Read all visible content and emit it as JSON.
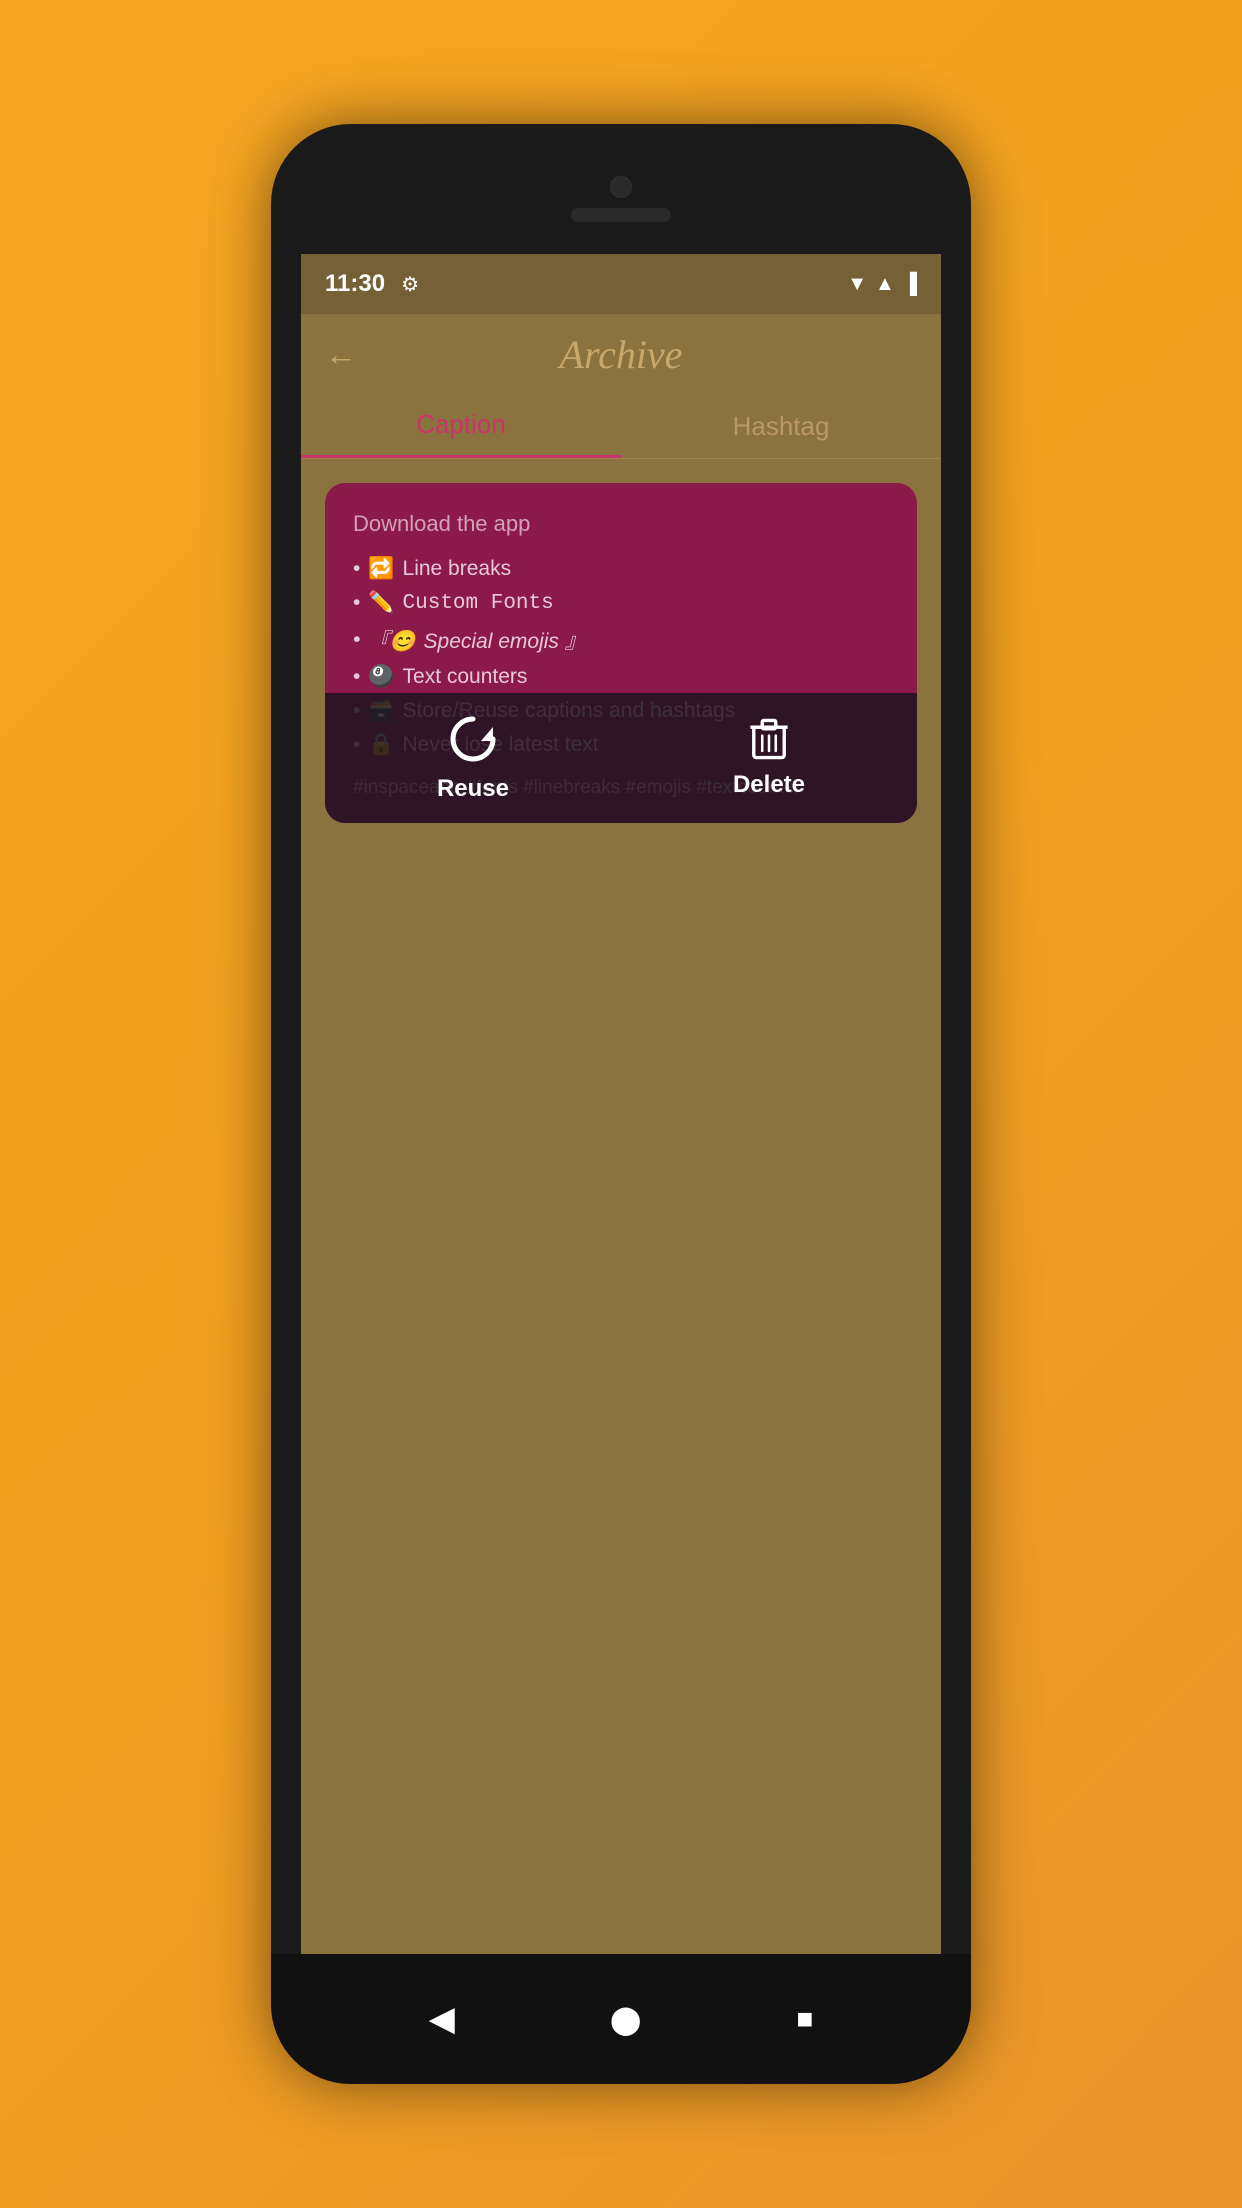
{
  "phone": {
    "status": {
      "time": "11:30",
      "wifi_icon": "▼",
      "signal_icon": "▲",
      "battery_icon": "🔋"
    },
    "header": {
      "back_label": "←",
      "title": "Archive"
    },
    "tabs": [
      {
        "id": "caption",
        "label": "Caption",
        "active": true
      },
      {
        "id": "hashtag",
        "label": "Hashtag",
        "active": false
      }
    ],
    "card": {
      "title": "Download the app",
      "items": [
        {
          "icon": "🔁",
          "text": "Line breaks"
        },
        {
          "icon": "✏️",
          "text": "Custom Fonts"
        },
        {
          "icon": "『😊",
          "text": "Special emojis 』"
        },
        {
          "icon": "🎱",
          "text": "Text counters"
        },
        {
          "icon": "🗃️",
          "text": "Store/Reuse captions and hashtags"
        },
        {
          "icon": "🔒",
          "text": "Never lose latest text"
        }
      ],
      "hashtags": "#inspaceapp #fonts #linebreaks #emojis #textcounter"
    },
    "actions": {
      "reuse_label": "Reuse",
      "delete_label": "Delete"
    },
    "nav": {
      "back": "◀",
      "home": "⬤",
      "recent": "■"
    }
  }
}
